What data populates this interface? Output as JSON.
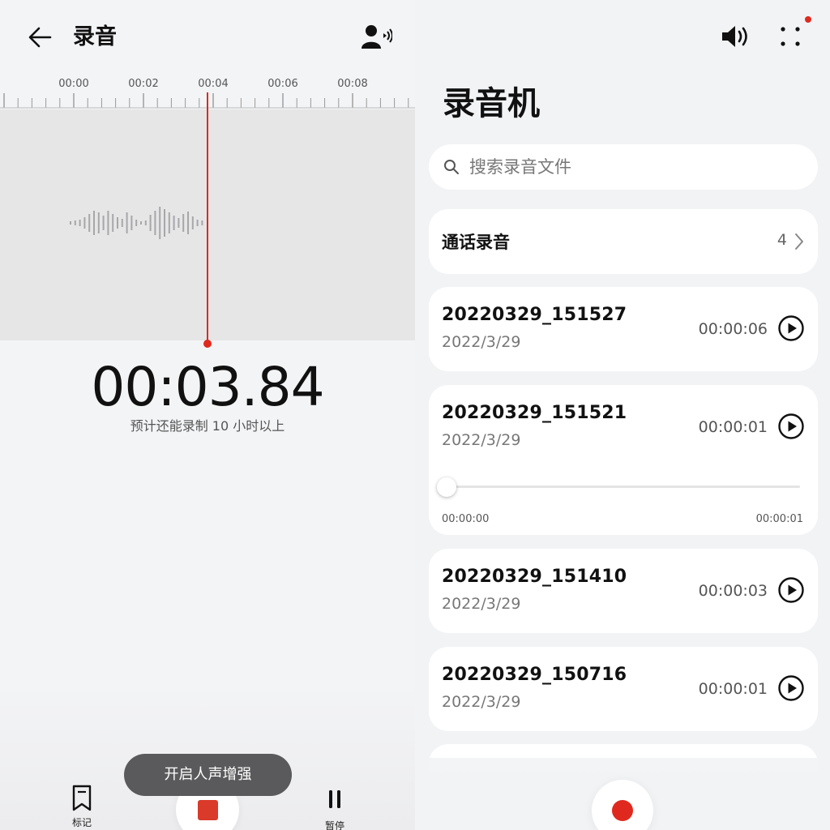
{
  "recorder": {
    "title": "录音",
    "ruler_labels": [
      "00:00",
      "00:02",
      "00:04",
      "00:06",
      "00:08"
    ],
    "elapsed": "00:03.84",
    "remaining_text": "预计还能录制 10 小时以上",
    "toast": "开启人声增强",
    "mark_label": "标记",
    "pause_label": "暂停",
    "icons": {
      "back": "arrow-left-icon",
      "voice": "voice-enhance-icon",
      "mark": "bookmark-icon",
      "stop": "stop-icon",
      "pause": "pause-icon"
    }
  },
  "list": {
    "title": "录音机",
    "search_placeholder": "搜索录音文件",
    "call_recordings": {
      "label": "通话录音",
      "count": "4"
    },
    "recordings": [
      {
        "name": "20220329_151527",
        "date": "2022/3/29",
        "duration": "00:00:06"
      },
      {
        "name": "20220329_151521",
        "date": "2022/3/29",
        "duration": "00:00:01",
        "expanded": true,
        "progress_start": "00:00:00",
        "progress_end": "00:00:01",
        "progress": 0
      },
      {
        "name": "20220329_151410",
        "date": "2022/3/29",
        "duration": "00:00:03"
      },
      {
        "name": "20220329_150716",
        "date": "2022/3/29",
        "duration": "00:00:01"
      }
    ],
    "icons": {
      "speaker": "speaker-icon",
      "more": "more-icon",
      "search": "search-icon",
      "play": "play-icon",
      "record": "record-icon"
    }
  },
  "colors": {
    "accent": "#e0291e",
    "stop": "#d93a2a",
    "background": "#f2f3f5"
  }
}
